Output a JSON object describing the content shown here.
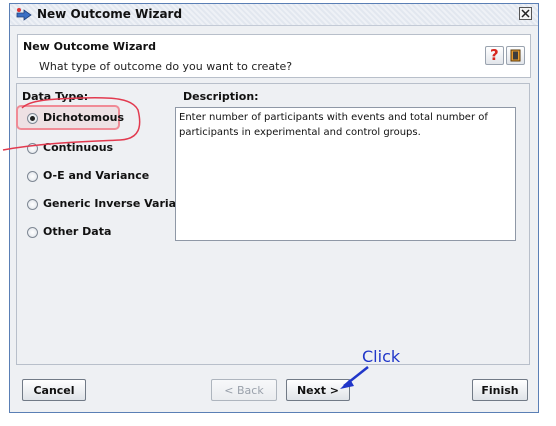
{
  "window": {
    "title": "New Outcome Wizard",
    "icons": {
      "app": "wizard-icon",
      "close": "close-icon"
    }
  },
  "header": {
    "title": "New Outcome Wizard",
    "subtitle": "What type of outcome do you want to create?",
    "help_glyph": "?",
    "icons": {
      "help": "help-icon",
      "book": "book-icon"
    }
  },
  "data_type": {
    "label": "Data Type:",
    "selected": "Dichotomous",
    "options": [
      {
        "label": "Dichotomous",
        "checked": true
      },
      {
        "label": "Continuous",
        "checked": false
      },
      {
        "label": "O-E and Variance",
        "checked": false
      },
      {
        "label": "Generic Inverse Variance",
        "checked": false
      },
      {
        "label": "Other Data",
        "checked": false
      }
    ]
  },
  "description": {
    "label": "Description:",
    "text": "Enter number of participants with events and total number of participants in experimental and control groups."
  },
  "buttons": {
    "cancel": "Cancel",
    "back": "< Back",
    "next": "Next >",
    "finish": "Finish"
  },
  "annotation": {
    "text": "Click",
    "color": "#2036c9",
    "highlight_color": "#f08b96"
  }
}
